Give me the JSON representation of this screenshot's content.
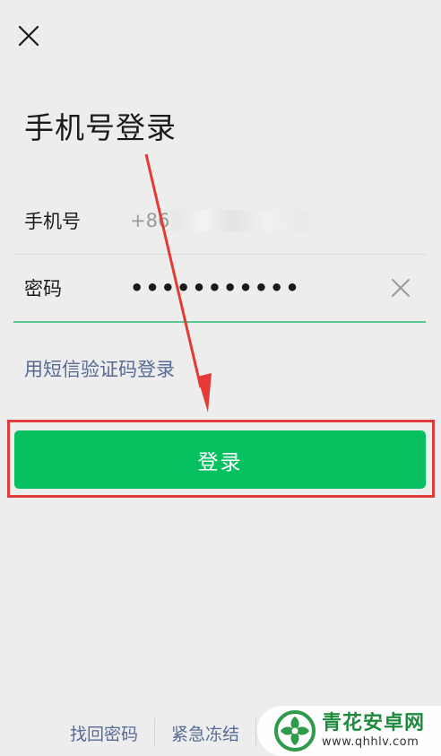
{
  "page": {
    "title": "手机号登录"
  },
  "phone_row": {
    "label": "手机号",
    "value_prefix": "+86"
  },
  "password_row": {
    "label": "密码",
    "value_masked": "•••••••••••"
  },
  "sms_login_link": "用短信验证码登录",
  "login_button": "登录",
  "footer": {
    "links": [
      "找回密码",
      "紧急冻结"
    ]
  },
  "watermark": {
    "name": "青花安卓网",
    "url": "www.qhhlv.com"
  },
  "colors": {
    "background": "#ededed",
    "primary_green": "#07c160",
    "link_blue": "#576b95",
    "focus_underline": "#5cc793",
    "annotation_red": "#e03b3b"
  },
  "icons": {
    "close": "close-icon",
    "clear": "clear-icon"
  }
}
